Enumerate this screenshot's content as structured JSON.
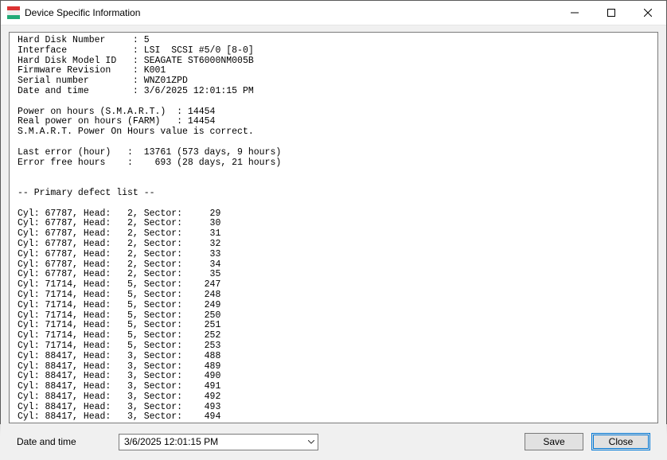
{
  "titlebar": {
    "title": "Device Specific Information"
  },
  "bottom": {
    "label": "Date and time",
    "datetime_value": "3/6/2025 12:01:15 PM",
    "save_label": "Save",
    "close_label": "Close"
  },
  "report": {
    "info": {
      "hard_disk_number": {
        "label": "Hard Disk Number",
        "value": "5"
      },
      "interface": {
        "label": "Interface",
        "value": "LSI  SCSI #5/0 [8-0]"
      },
      "model_id": {
        "label": "Hard Disk Model ID",
        "value": "SEAGATE ST6000NM005B"
      },
      "firmware": {
        "label": "Firmware Revision",
        "value": "K001"
      },
      "serial": {
        "label": "Serial number",
        "value": "WNZ01ZPD"
      },
      "datetime": {
        "label": "Date and time",
        "value": "3/6/2025 12:01:15 PM"
      }
    },
    "power": {
      "smart_hours": {
        "label": "Power on hours (S.M.A.R.T.)",
        "value": "14454"
      },
      "farm_hours": {
        "label": "Real power on hours (FARM)",
        "value": "14454"
      },
      "note": "S.M.A.R.T. Power On Hours value is correct."
    },
    "errors": {
      "last_error": {
        "label": "Last error (hour)",
        "value": "13761",
        "detail": "(573 days, 9 hours)"
      },
      "error_free": {
        "label": "Error free hours",
        "value": "693",
        "detail": "(28 days, 21 hours)"
      }
    },
    "defect_header": "-- Primary defect list --",
    "defects": [
      {
        "cyl": 67787,
        "head": 2,
        "sector": 29
      },
      {
        "cyl": 67787,
        "head": 2,
        "sector": 30
      },
      {
        "cyl": 67787,
        "head": 2,
        "sector": 31
      },
      {
        "cyl": 67787,
        "head": 2,
        "sector": 32
      },
      {
        "cyl": 67787,
        "head": 2,
        "sector": 33
      },
      {
        "cyl": 67787,
        "head": 2,
        "sector": 34
      },
      {
        "cyl": 67787,
        "head": 2,
        "sector": 35
      },
      {
        "cyl": 71714,
        "head": 5,
        "sector": 247
      },
      {
        "cyl": 71714,
        "head": 5,
        "sector": 248
      },
      {
        "cyl": 71714,
        "head": 5,
        "sector": 249
      },
      {
        "cyl": 71714,
        "head": 5,
        "sector": 250
      },
      {
        "cyl": 71714,
        "head": 5,
        "sector": 251
      },
      {
        "cyl": 71714,
        "head": 5,
        "sector": 252
      },
      {
        "cyl": 71714,
        "head": 5,
        "sector": 253
      },
      {
        "cyl": 88417,
        "head": 3,
        "sector": 488
      },
      {
        "cyl": 88417,
        "head": 3,
        "sector": 489
      },
      {
        "cyl": 88417,
        "head": 3,
        "sector": 490
      },
      {
        "cyl": 88417,
        "head": 3,
        "sector": 491
      },
      {
        "cyl": 88417,
        "head": 3,
        "sector": 492
      },
      {
        "cyl": 88417,
        "head": 3,
        "sector": 493
      },
      {
        "cyl": 88417,
        "head": 3,
        "sector": 494
      }
    ]
  }
}
